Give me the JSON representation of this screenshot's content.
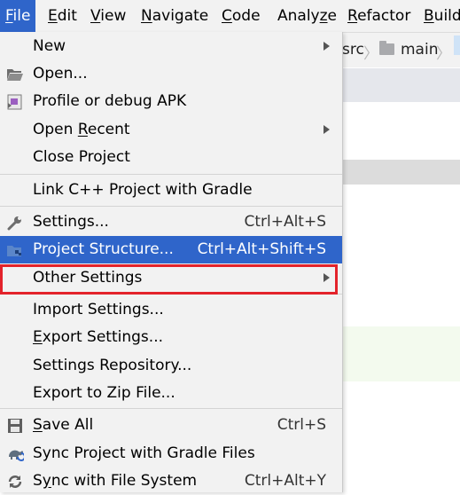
{
  "menubar": {
    "items": [
      {
        "label": "File",
        "underline": "F"
      },
      {
        "label": "Edit",
        "underline": "E"
      },
      {
        "label": "View",
        "underline": "V"
      },
      {
        "label": "Navigate",
        "underline": "N"
      },
      {
        "label": "Code",
        "underline": "C"
      },
      {
        "label": "Analyze",
        "underline": "z"
      },
      {
        "label": "Refactor",
        "underline": "R"
      },
      {
        "label": "Build",
        "underline": "B"
      }
    ]
  },
  "breadcrumb": {
    "src": "src",
    "main": "main",
    "separator": "〉"
  },
  "menu": {
    "new": "New",
    "open": "Open...",
    "profile_apk": "Profile or debug APK",
    "open_recent": "Open Recent",
    "close_project": "Close Project",
    "link_cpp": "Link C++ Project with Gradle",
    "settings": "Settings...",
    "settings_sc": "Ctrl+Alt+S",
    "project_structure": "Project Structure...",
    "project_structure_sc": "Ctrl+Alt+Shift+S",
    "other_settings": "Other Settings",
    "import_settings": "Import Settings...",
    "export_settings": "Export Settings...",
    "settings_repository": "Settings Repository...",
    "export_zip": "Export to Zip File...",
    "save_all": "Save All",
    "save_all_sc": "Ctrl+S",
    "sync_gradle": "Sync Project with Gradle Files",
    "sync_fs": "Sync with File System",
    "sync_fs_sc": "Ctrl+Alt+Y"
  },
  "colors": {
    "selection": "#2f65ca",
    "highlight_box": "#e3232b",
    "menu_bg": "#f2f2f2"
  }
}
